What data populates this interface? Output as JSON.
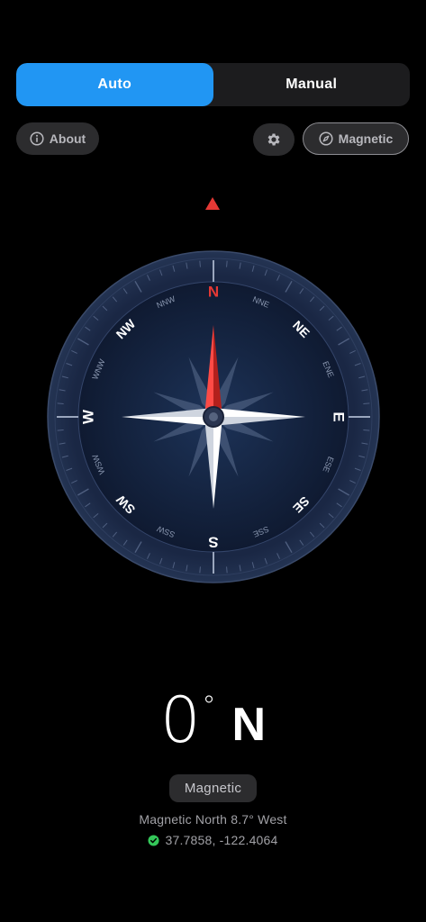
{
  "mode_tabs": [
    {
      "label": "Auto",
      "active": true
    },
    {
      "label": "Manual",
      "active": false
    }
  ],
  "toolbar": {
    "about_label": "About",
    "about_icon": "info-circle-icon",
    "settings_icon": "gear-icon",
    "north_label": "Magnetic",
    "north_icon": "compass-needle-icon"
  },
  "compass": {
    "cardinals": [
      "N",
      "E",
      "S",
      "W"
    ],
    "intercardinals": [
      "NE",
      "SE",
      "SW",
      "NW"
    ],
    "secondary": [
      "NNE",
      "ENE",
      "ESE",
      "SSE",
      "SSW",
      "WSW",
      "WNW",
      "NNW"
    ],
    "heading_degrees": 0,
    "marker_color": "#e53935",
    "north_needle_color": "#e53935"
  },
  "readout": {
    "degrees": "0",
    "degree_symbol": "°",
    "direction": "N",
    "reference_badge": "Magnetic",
    "declination": "Magnetic North 8.7° West",
    "coordinates": "37.7858, -122.4064",
    "location_status_color": "#34c759"
  },
  "colors": {
    "accent": "#2196f3",
    "dial_face": "#14213d",
    "dial_ring": "#1c2a45"
  }
}
